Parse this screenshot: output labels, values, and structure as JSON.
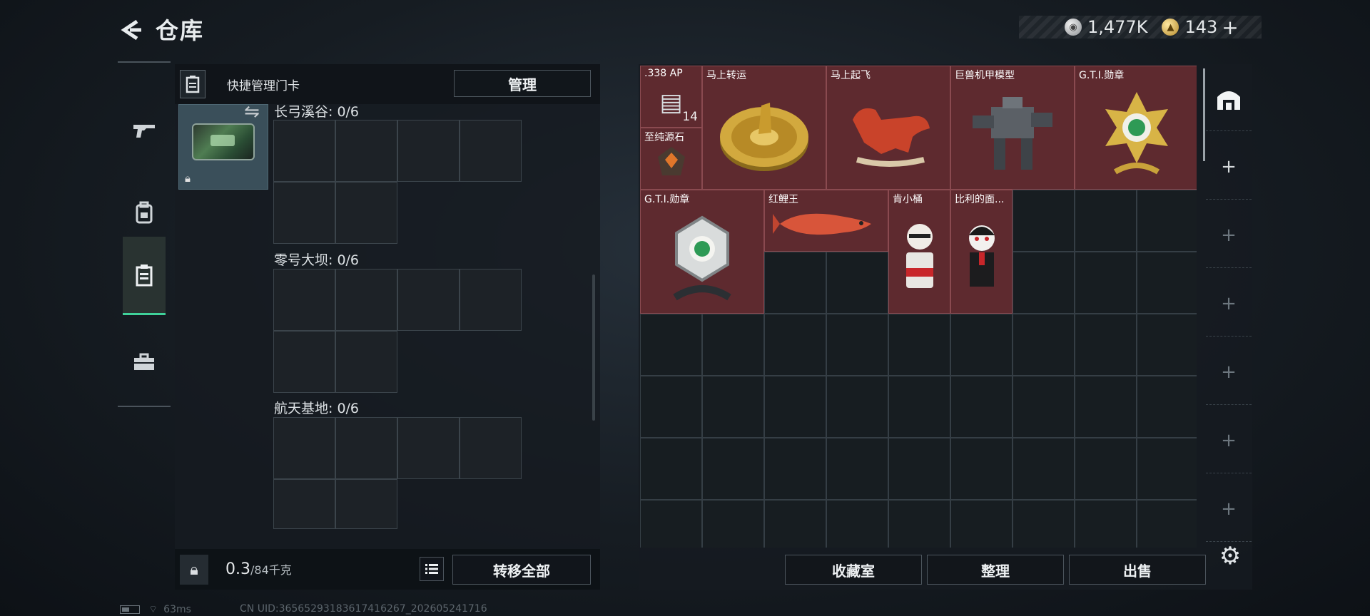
{
  "header": {
    "title": "仓库",
    "currency_silver": "1,477K",
    "currency_gold": "143",
    "plus": "+"
  },
  "nav": {
    "items": [
      {
        "name": "weapons",
        "icon": "gun-icon"
      },
      {
        "name": "gear",
        "icon": "backpack-icon"
      },
      {
        "name": "keycards",
        "icon": "keycard-icon",
        "active": true
      },
      {
        "name": "toolbox",
        "icon": "briefcase-icon"
      }
    ]
  },
  "left_panel": {
    "title": "快捷管理门卡",
    "manage_label": "管理",
    "maps": [
      {
        "label": "长弓溪谷: 0/6"
      },
      {
        "label": "零号大坝: 0/6"
      },
      {
        "label": "航天基地: 0/6"
      }
    ],
    "weight_current": "0.3",
    "weight_max": "/84千克",
    "transfer_label": "转移全部"
  },
  "inventory": {
    "items": [
      {
        "name": ".338 AP",
        "count": "14",
        "icon": "ammo-icon"
      },
      {
        "name": "马上转运",
        "icon": "golden-compass-icon"
      },
      {
        "name": "马上起飞",
        "icon": "red-horse-icon"
      },
      {
        "name": "巨兽机甲模型",
        "icon": "mech-model-icon"
      },
      {
        "name": "G.T.I.勋章",
        "icon": "gold-medal-icon"
      },
      {
        "name": "至纯源石",
        "icon": "gem-icon"
      },
      {
        "name": "G.T.I.勋章",
        "icon": "silver-medal-icon"
      },
      {
        "name": "红鲤王",
        "icon": "red-carp-icon"
      },
      {
        "name": "肯小桶",
        "icon": "figurine-icon"
      },
      {
        "name": "比利的面...",
        "icon": "puppet-icon"
      }
    ]
  },
  "footer": {
    "collection_label": "收藏室",
    "sort_label": "整理",
    "sell_label": "出售"
  },
  "status": {
    "ping": "63ms",
    "uid": "CN UID:3656529318361741626­7_202605241716"
  }
}
